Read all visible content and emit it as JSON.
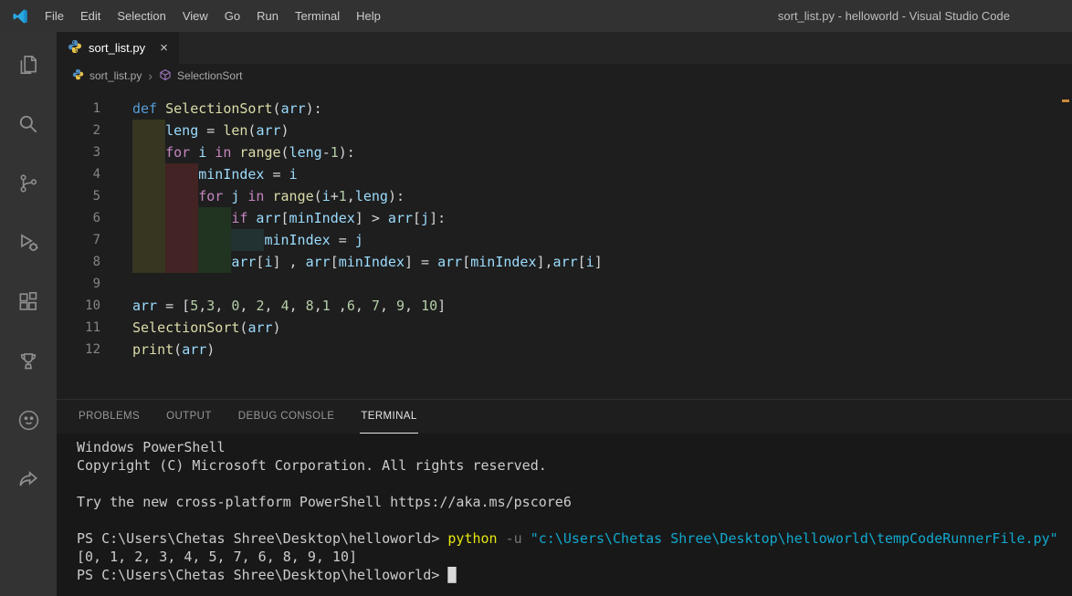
{
  "window": {
    "title": "sort_list.py - helloworld - Visual Studio Code"
  },
  "menu": {
    "items": [
      "File",
      "Edit",
      "Selection",
      "View",
      "Go",
      "Run",
      "Terminal",
      "Help"
    ]
  },
  "activity_bar": {
    "items": [
      "explorer-icon",
      "search-icon",
      "source-control-icon",
      "run-debug-icon",
      "extensions-icon",
      "trophy-icon",
      "paw-icon",
      "share-icon"
    ]
  },
  "tab": {
    "label": "sort_list.py",
    "close_glyph": "×"
  },
  "breadcrumb": {
    "file": "sort_list.py",
    "separator": "›",
    "symbol": "SelectionSort"
  },
  "editor": {
    "lines": [
      {
        "num": "1",
        "indent": 0,
        "tokens": [
          [
            "kw",
            "def"
          ],
          [
            "pl",
            " "
          ],
          [
            "fn",
            "SelectionSort"
          ],
          [
            "pl",
            "("
          ],
          [
            "var",
            "arr"
          ],
          [
            "pl",
            "):"
          ]
        ]
      },
      {
        "num": "2",
        "indent": 1,
        "tokens": [
          [
            "var",
            "leng"
          ],
          [
            "pl",
            " = "
          ],
          [
            "fn",
            "len"
          ],
          [
            "pl",
            "("
          ],
          [
            "var",
            "arr"
          ],
          [
            "pl",
            ")"
          ]
        ]
      },
      {
        "num": "3",
        "indent": 1,
        "tokens": [
          [
            "ctrl",
            "for"
          ],
          [
            "pl",
            " "
          ],
          [
            "var",
            "i"
          ],
          [
            "pl",
            " "
          ],
          [
            "ctrl",
            "in"
          ],
          [
            "pl",
            " "
          ],
          [
            "fn",
            "range"
          ],
          [
            "pl",
            "("
          ],
          [
            "var",
            "leng"
          ],
          [
            "pl",
            "-"
          ],
          [
            "num",
            "1"
          ],
          [
            "pl",
            "):"
          ]
        ]
      },
      {
        "num": "4",
        "indent": 2,
        "tokens": [
          [
            "var",
            "minIndex"
          ],
          [
            "pl",
            " = "
          ],
          [
            "var",
            "i"
          ]
        ]
      },
      {
        "num": "5",
        "indent": 2,
        "tokens": [
          [
            "ctrl",
            "for"
          ],
          [
            "pl",
            " "
          ],
          [
            "var",
            "j"
          ],
          [
            "pl",
            " "
          ],
          [
            "ctrl",
            "in"
          ],
          [
            "pl",
            " "
          ],
          [
            "fn",
            "range"
          ],
          [
            "pl",
            "("
          ],
          [
            "var",
            "i"
          ],
          [
            "pl",
            "+"
          ],
          [
            "num",
            "1"
          ],
          [
            "pl",
            ","
          ],
          [
            "var",
            "leng"
          ],
          [
            "pl",
            "):"
          ]
        ]
      },
      {
        "num": "6",
        "indent": 3,
        "tokens": [
          [
            "ctrl",
            "if"
          ],
          [
            "pl",
            " "
          ],
          [
            "var",
            "arr"
          ],
          [
            "pl",
            "["
          ],
          [
            "var",
            "minIndex"
          ],
          [
            "pl",
            "] > "
          ],
          [
            "var",
            "arr"
          ],
          [
            "pl",
            "["
          ],
          [
            "var",
            "j"
          ],
          [
            "pl",
            "]:"
          ]
        ]
      },
      {
        "num": "7",
        "indent": 4,
        "tokens": [
          [
            "var",
            "minIndex"
          ],
          [
            "pl",
            " = "
          ],
          [
            "var",
            "j"
          ]
        ]
      },
      {
        "num": "8",
        "indent": 3,
        "tokens": [
          [
            "var",
            "arr"
          ],
          [
            "pl",
            "["
          ],
          [
            "var",
            "i"
          ],
          [
            "pl",
            "] , "
          ],
          [
            "var",
            "arr"
          ],
          [
            "pl",
            "["
          ],
          [
            "var",
            "minIndex"
          ],
          [
            "pl",
            "] = "
          ],
          [
            "var",
            "arr"
          ],
          [
            "pl",
            "["
          ],
          [
            "var",
            "minIndex"
          ],
          [
            "pl",
            "],"
          ],
          [
            "var",
            "arr"
          ],
          [
            "pl",
            "["
          ],
          [
            "var",
            "i"
          ],
          [
            "pl",
            "]"
          ]
        ]
      },
      {
        "num": "9",
        "indent": 0,
        "tokens": []
      },
      {
        "num": "10",
        "indent": 0,
        "tokens": [
          [
            "var",
            "arr"
          ],
          [
            "pl",
            " = ["
          ],
          [
            "num",
            "5"
          ],
          [
            "pl",
            ","
          ],
          [
            "num",
            "3"
          ],
          [
            "pl",
            ", "
          ],
          [
            "num",
            "0"
          ],
          [
            "pl",
            ", "
          ],
          [
            "num",
            "2"
          ],
          [
            "pl",
            ", "
          ],
          [
            "num",
            "4"
          ],
          [
            "pl",
            ", "
          ],
          [
            "num",
            "8"
          ],
          [
            "pl",
            ","
          ],
          [
            "num",
            "1"
          ],
          [
            "pl",
            " ,"
          ],
          [
            "num",
            "6"
          ],
          [
            "pl",
            ", "
          ],
          [
            "num",
            "7"
          ],
          [
            "pl",
            ", "
          ],
          [
            "num",
            "9"
          ],
          [
            "pl",
            ", "
          ],
          [
            "num",
            "10"
          ],
          [
            "pl",
            "]"
          ]
        ]
      },
      {
        "num": "11",
        "indent": 0,
        "tokens": [
          [
            "fn",
            "SelectionSort"
          ],
          [
            "pl",
            "("
          ],
          [
            "var",
            "arr"
          ],
          [
            "pl",
            ")"
          ]
        ]
      },
      {
        "num": "12",
        "indent": 0,
        "tokens": [
          [
            "fn",
            "print"
          ],
          [
            "pl",
            "("
          ],
          [
            "var",
            "arr"
          ],
          [
            "pl",
            ")"
          ]
        ]
      }
    ]
  },
  "panel": {
    "tabs": [
      {
        "label": "PROBLEMS",
        "active": false
      },
      {
        "label": "OUTPUT",
        "active": false
      },
      {
        "label": "DEBUG CONSOLE",
        "active": false
      },
      {
        "label": "TERMINAL",
        "active": true
      }
    ]
  },
  "terminal": {
    "lines": [
      [
        [
          "t",
          "Windows PowerShell"
        ]
      ],
      [
        [
          "t",
          "Copyright (C) Microsoft Corporation. All rights reserved."
        ]
      ],
      [],
      [
        [
          "t",
          "Try the new cross-platform PowerShell https://aka.ms/pscore6"
        ]
      ],
      [],
      [
        [
          "t",
          "PS C:\\Users\\Chetas Shree\\Desktop\\helloworld> "
        ],
        [
          "cmd",
          "python"
        ],
        [
          "t",
          " "
        ],
        [
          "param",
          "-u"
        ],
        [
          "t",
          " "
        ],
        [
          "str",
          "\"c:\\Users\\Chetas Shree\\Desktop\\helloworld\\tempCodeRunnerFile.py\""
        ]
      ],
      [
        [
          "t",
          "[0, 1, 2, 3, 4, 5, 7, 6, 8, 9, 10]"
        ]
      ],
      [
        [
          "t",
          "PS C:\\Users\\Chetas Shree\\Desktop\\helloworld> "
        ],
        [
          "cursor",
          "█"
        ]
      ]
    ]
  },
  "colors": {
    "keyword": "#569cd6",
    "control_keyword": "#c586c0",
    "function_name": "#dcdcaa",
    "variable": "#9cdcfe",
    "number": "#b5cea8",
    "terminal_command": "#e5e510",
    "terminal_string": "#11a8cd",
    "titlebar_bg": "#323233",
    "activitybar_bg": "#333333",
    "editor_bg": "#1e1e1e",
    "terminal_bg": "#181818"
  }
}
